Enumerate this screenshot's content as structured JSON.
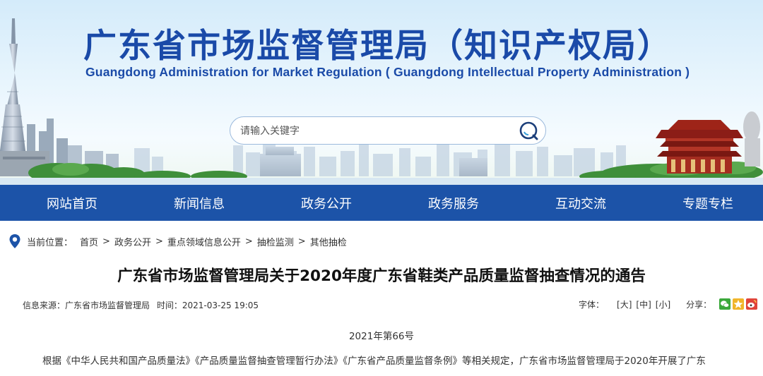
{
  "header": {
    "title": "广东省市场监督管理局（知识产权局）",
    "subtitle": "Guangdong Administration for Market Regulation ( Guangdong Intellectual Property Administration )"
  },
  "search": {
    "placeholder": "请输入关键字",
    "icon": "search-icon"
  },
  "nav": {
    "items": [
      {
        "label": "网站首页"
      },
      {
        "label": "新闻信息"
      },
      {
        "label": "政务公开"
      },
      {
        "label": "政务服务"
      },
      {
        "label": "互动交流"
      },
      {
        "label": "专题专栏"
      }
    ]
  },
  "breadcrumb": {
    "prefix": "当前位置：",
    "items": [
      "首页",
      "政务公开",
      "重点领域信息公开",
      "抽检监测",
      "其他抽检"
    ],
    "separator": ">"
  },
  "article": {
    "title": "广东省市场监督管理局关于2020年度广东省鞋类产品质量监督抽查情况的通告",
    "source_label": "信息来源：",
    "source": "广东省市场监督管理局",
    "time_label": "时间：",
    "time": "2021-03-25 19:05",
    "font_label": "字体：",
    "font_large": "[大]",
    "font_medium": "[中]",
    "font_small": "[小]",
    "share_label": "分享：",
    "doc_number": "2021年第66号",
    "body_first_line": "根据《中华人民共和国产品质量法》《产品质量监督抽查管理暂行办法》《广东省产品质量监督条例》等相关规定，广东省市场监督管理局于2020年开展了广东"
  },
  "colors": {
    "brand_blue": "#1c53a8",
    "title_blue": "#1a4aa8",
    "pin_blue": "#1c53a8"
  }
}
